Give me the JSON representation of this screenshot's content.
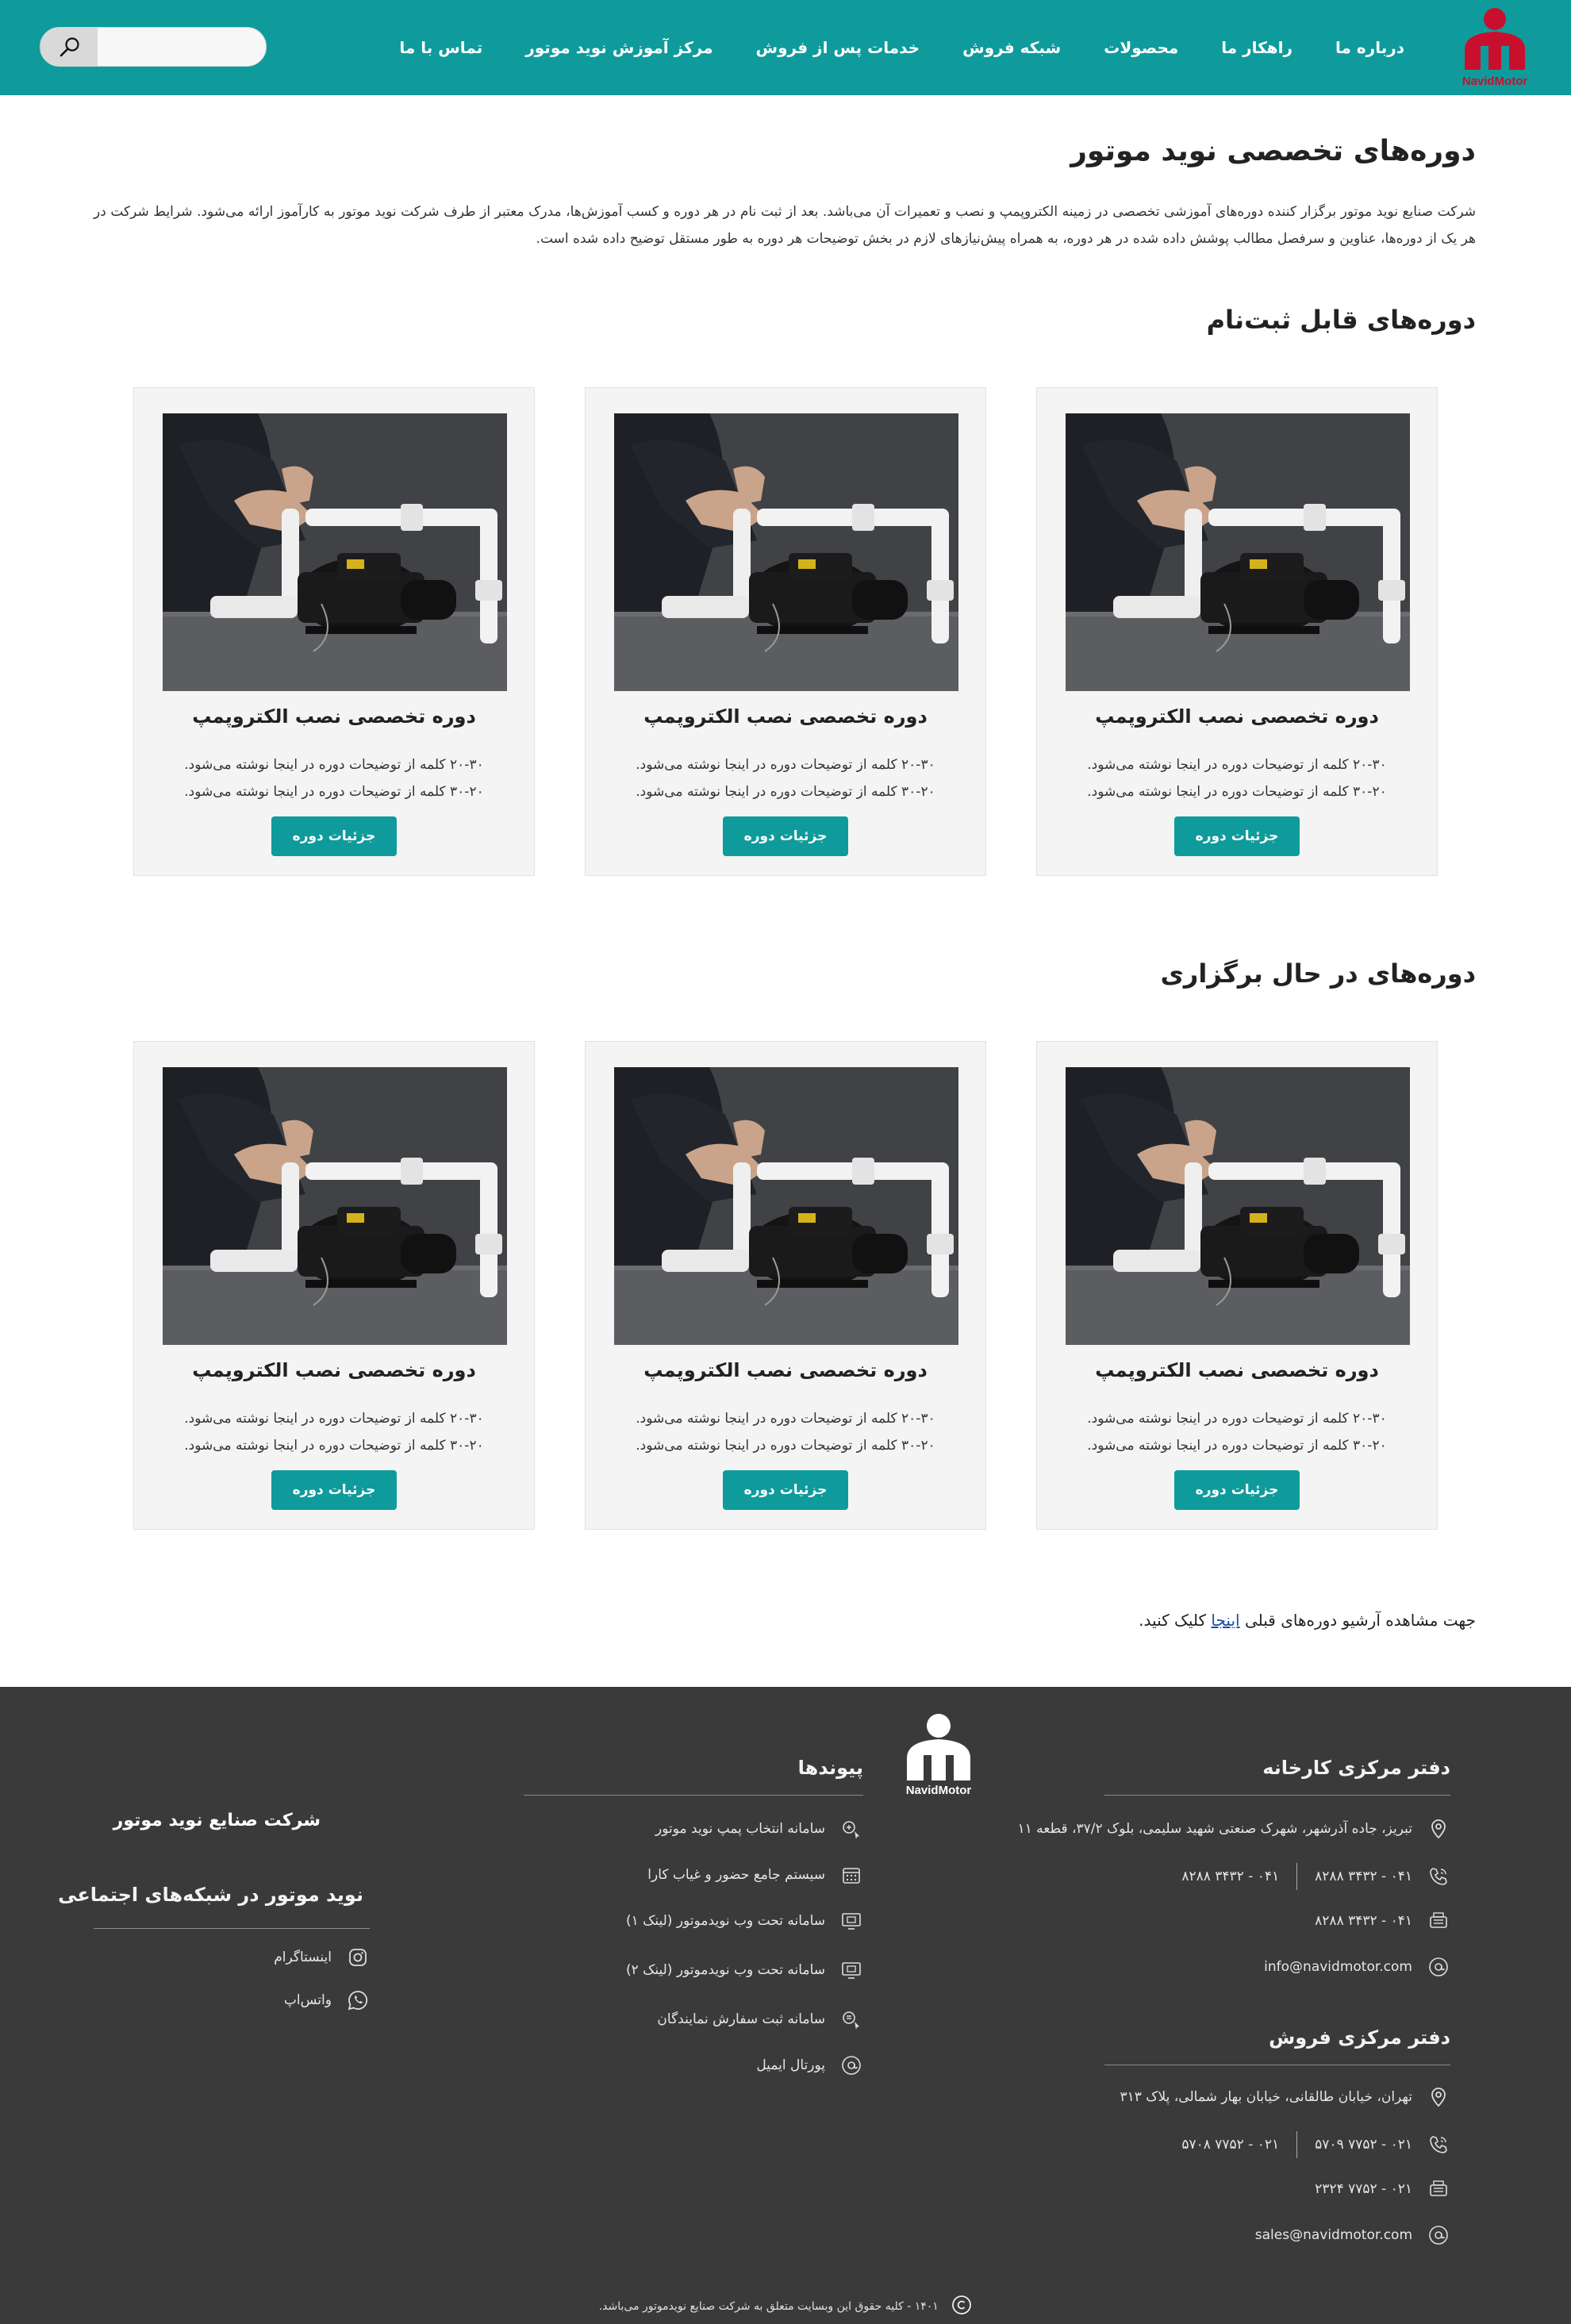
{
  "brand": {
    "logo_text": "NavidMotor",
    "primary_color": "#0f9b9c",
    "logo_color": "#c8102e"
  },
  "nav": {
    "items": [
      {
        "label": "درباره ما"
      },
      {
        "label": "راهکار ما"
      },
      {
        "label": "محصولات"
      },
      {
        "label": "شبکه فروش"
      },
      {
        "label": "خدمات پس از فروش"
      },
      {
        "label": "مرکز آموزش نوید موتور"
      },
      {
        "label": "تماس با ما"
      }
    ]
  },
  "search": {
    "placeholder": "",
    "icon": "search-icon"
  },
  "page": {
    "title": "دوره‌های تخصصی نوید موتور",
    "intro": "شرکت صنایع نوید موتور برگزار کننده دوره‌های آموزشی تخصصی در زمینه الکتروپمپ و نصب و تعمیرات آن می‌باشد. بعد از ثبت نام در هر دوره و کسب آموزش‌ها، مدرک معتبر از طرف شرکت نوید موتور به کارآموز ارائه می‌شود. شرایط شرکت در هر یک از دوره‌ها، عناوین و سرفصل مطالب پوشش داده شده در هر دوره، به همراه پیش‌نیازهای لازم در بخش توضیحات هر دوره به طور مستقل توضیح داده شده است."
  },
  "sections": {
    "registrable": {
      "title": "دوره‌های قابل ثبت‌نام",
      "cards": [
        {
          "title": "دوره تخصصی نصب الکتروپمپ",
          "desc1": "۲۰-۳۰ کلمه از توضیحات دوره در اینجا نوشته می‌شود.",
          "desc2": "۳۰-۲۰ کلمه از توضیحات دوره در اینجا نوشته می‌شود.",
          "button": "جزئیات دوره"
        },
        {
          "title": "دوره تخصصی نصب الکتروپمپ",
          "desc1": "۲۰-۳۰ کلمه از توضیحات دوره در اینجا نوشته می‌شود.",
          "desc2": "۳۰-۲۰ کلمه از توضیحات دوره در اینجا نوشته می‌شود.",
          "button": "جزئیات دوره"
        },
        {
          "title": "دوره تخصصی نصب الکتروپمپ",
          "desc1": "۲۰-۳۰ کلمه از توضیحات دوره در اینجا نوشته می‌شود.",
          "desc2": "۳۰-۲۰ کلمه از توضیحات دوره در اینجا نوشته می‌شود.",
          "button": "جزئیات دوره"
        }
      ]
    },
    "ongoing": {
      "title": "دوره‌های در حال برگزاری",
      "cards": [
        {
          "title": "دوره تخصصی نصب الکتروپمپ",
          "desc1": "۲۰-۳۰ کلمه از توضیحات دوره در اینجا نوشته می‌شود.",
          "desc2": "۳۰-۲۰ کلمه از توضیحات دوره در اینجا نوشته می‌شود.",
          "button": "جزئیات دوره"
        },
        {
          "title": "دوره تخصصی نصب الکتروپمپ",
          "desc1": "۲۰-۳۰ کلمه از توضیحات دوره در اینجا نوشته می‌شود.",
          "desc2": "۳۰-۲۰ کلمه از توضیحات دوره در اینجا نوشته می‌شود.",
          "button": "جزئیات دوره"
        },
        {
          "title": "دوره تخصصی نصب الکتروپمپ",
          "desc1": "۲۰-۳۰ کلمه از توضیحات دوره در اینجا نوشته می‌شود.",
          "desc2": "۳۰-۲۰ کلمه از توضیحات دوره در اینجا نوشته می‌شود.",
          "button": "جزئیات دوره"
        }
      ]
    }
  },
  "archive": {
    "prefix": "جهت مشاهده آرشیو دوره‌های قبلی",
    "link": "اینجا",
    "suffix": "کلیک کنید."
  },
  "footer": {
    "factory": {
      "title": "دفتر مرکزی کارخانه",
      "address": "تبریز، جاده آذرشهر، شهرک صنعتی شهید سلیمی، بلوک ۳۷/۲، قطعه ۱۱",
      "phone1": "۰۴۱ - ۳۴۳۲ ۸۲۸۸",
      "phone2": "۰۴۱ - ۳۴۳۲ ۸۲۸۸",
      "fax": "۰۴۱ - ۳۴۳۲ ۸۲۸۸",
      "email": "info@navidmotor.com"
    },
    "sales": {
      "title": "دفتر مرکزی فروش",
      "address": "تهران، خیابان طالقانی، خیابان بهار شمالی، پلاک ۳۱۳",
      "phone1": "۰۲۱ - ۷۷۵۲ ۵۷۰۹",
      "phone2": "۰۲۱ - ۷۷۵۲ ۵۷۰۸",
      "fax": "۰۲۱ - ۷۷۵۲ ۲۳۲۴",
      "email": "sales@navidmotor.com"
    },
    "links": {
      "title": "پیوندها",
      "items": [
        {
          "label": "سامانه انتخاب پمپ نوید موتور",
          "icon": "pump-select-icon"
        },
        {
          "label": "سیستم جامع حضور و غیاب کارا",
          "icon": "calendar-icon"
        },
        {
          "label": "سامانه تحت وب نویدموتور (لینک ۱)",
          "icon": "web-monitor-icon"
        },
        {
          "label": "سامانه تحت وب نویدموتور (لینک ۲)",
          "icon": "web-monitor-icon"
        },
        {
          "label": "سامانه ثبت سفارش نمایندگان",
          "icon": "order-icon"
        },
        {
          "label": "پورتال ایمیل",
          "icon": "at-icon"
        }
      ]
    },
    "company_name": "شرکت صنایع نوید موتور",
    "social": {
      "title": "نوید موتور در شبکه‌های اجتماعی",
      "items": [
        {
          "label": "اینستاگرام",
          "icon": "instagram-icon"
        },
        {
          "label": "واتس‌اپ",
          "icon": "whatsapp-icon"
        }
      ]
    },
    "copyright": "۱۴۰۱ - کلیه حقوق این وبسایت متعلق به شرکت صنایع نویدموتور می‌باشد.",
    "background_color": "#3a3a3a"
  }
}
